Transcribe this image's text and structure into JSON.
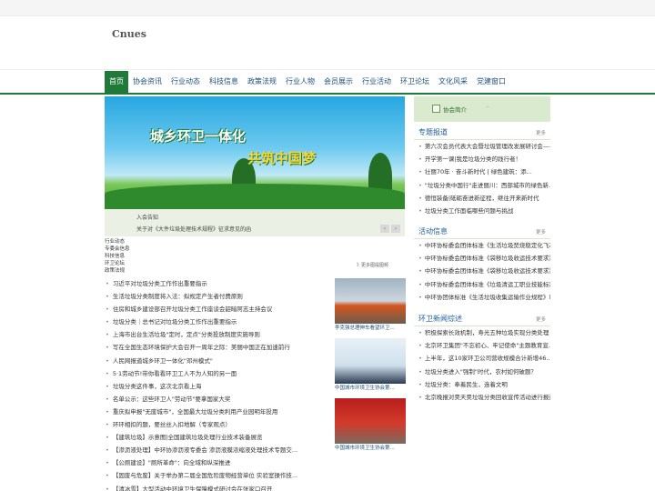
{
  "site": {
    "logo": "Cnues"
  },
  "nav": {
    "items": [
      "首页",
      "协会资讯",
      "行业动态",
      "科技信息",
      "政策法规",
      "行业人物",
      "会员展示",
      "行业活动",
      "环卫论坛",
      "文化风采",
      "党建窗口"
    ],
    "active_index": 0
  },
  "banner": {
    "title_left": "城乡环卫一体化",
    "title_right": "共筑中国梦",
    "caption_top": "入会告知",
    "caption_bottom": "关于对《大件垃圾处理技术规程》征求意见的函",
    "prev_icon": "chevron-left-icon",
    "next_icon": "chevron-right-icon"
  },
  "categories": [
    "行业动态",
    "专委会信息",
    "科技信息",
    "环卫论坛",
    "政策法规"
  ],
  "images_more": "》更多图提图频",
  "news": [
    "习近平对垃圾分类工作作出重要指示",
    "生活垃圾分类制度将入法：拟规定产生者付费原则",
    "住房和城乡建设部召开垃圾分类工作座谈会韶暗阿志主持会议",
    "垃圾分类｜总书记对垃圾分类工作作出重要指示",
    "上海市出台生活垃圾\"定时，定点\"分类投放制度实施导则",
    "写在全国生态环境保护大会召开一周年之际：美丽中国正在加速前行",
    "人民网报道城乡环卫一体化\"邓州模式\"",
    "5·1劳动节!带你看看环卫工人不为人知的另一面",
    "垃圾分类这件事，这次北京看上海",
    "名单公示：这些环卫人\"劳动节\"要拿国家大奖",
    "重庆拟申报\"无废城市\"，全国最大垃圾分类利用产业园明年投用",
    "环环相扣的题，要丝丝入扣地解（专家观点）",
    "【建筑垃圾】示意图|全国建筑垃圾处理行业技术装备展览",
    "【渗沥液处理】中环协渗沥液专委会 渗沥液膜浓缩液处理技术专题交...",
    "【公厕建设】\"厕所革命\"：向全域和纵深推进",
    "【固废与危废】关于举办第二届全国危险废物经营单位 实验室操作技...",
    "【清冰雪】大型活动中环境卫生保障模式研讨会在张家口召开"
  ],
  "thumbs": [
    {
      "label": "李克强总理伸车看望环卫..."
    },
    {
      "label": "中国城市环境卫生协会第..."
    },
    {
      "label": "中国城市环境卫生协会第..."
    }
  ],
  "intro": {
    "label": "协会简介",
    "dot": "·"
  },
  "sections": [
    {
      "title": "专题报道",
      "more": "更多",
      "items": [
        "第六次会员代表大会暨垃圾管理改发展研讨会——新...",
        "开学第一课|我是垃圾分类的践行者！",
        "壮丽70年 · 奋斗新时代 | 绿色建筑：添...",
        "\"垃圾分类中国行\"走进丽川：西部城市的绿色新...",
        "德恒装备|砥砺奋进新征程，继往开来新时代",
        "垃圾分类工作面临哪些问题与挑战"
      ]
    },
    {
      "title": "活动信息",
      "more": "更多",
      "items": [
        "中环协标委会团体标准《生活垃圾焚烧稳定化飞灰...",
        "中环协标委会团体标准《袋移垃圾收运技术要求》...",
        "中环协标委会团体标准《袋移垃圾收运技术要求》...",
        "中环协标委会团体标准《垃圾清运工职业技能标准...",
        "中环协团体标准《生活垃圾收集运输作业规程》审..."
      ]
    },
    {
      "title": "环卫新闻综述",
      "more": "更多",
      "items": [
        "积极探索长效机制，寿光五种垃圾实现分类处理",
        "北京环卫集团\"不忘初心、牢记使命\"主题教育宣...",
        "上半年，这10家环卫公司营收规模合计新增46...",
        "垃圾分类进入\"强制\"时代，农村如何破题？",
        "垃圾分类：奉着民生，连着文明",
        "北京晚报对昊天昊垃圾分类回收宣传活动进行报道"
      ]
    }
  ],
  "colors": {
    "brand_green": "#1f7a3a",
    "link_blue": "#1f5e9c"
  }
}
